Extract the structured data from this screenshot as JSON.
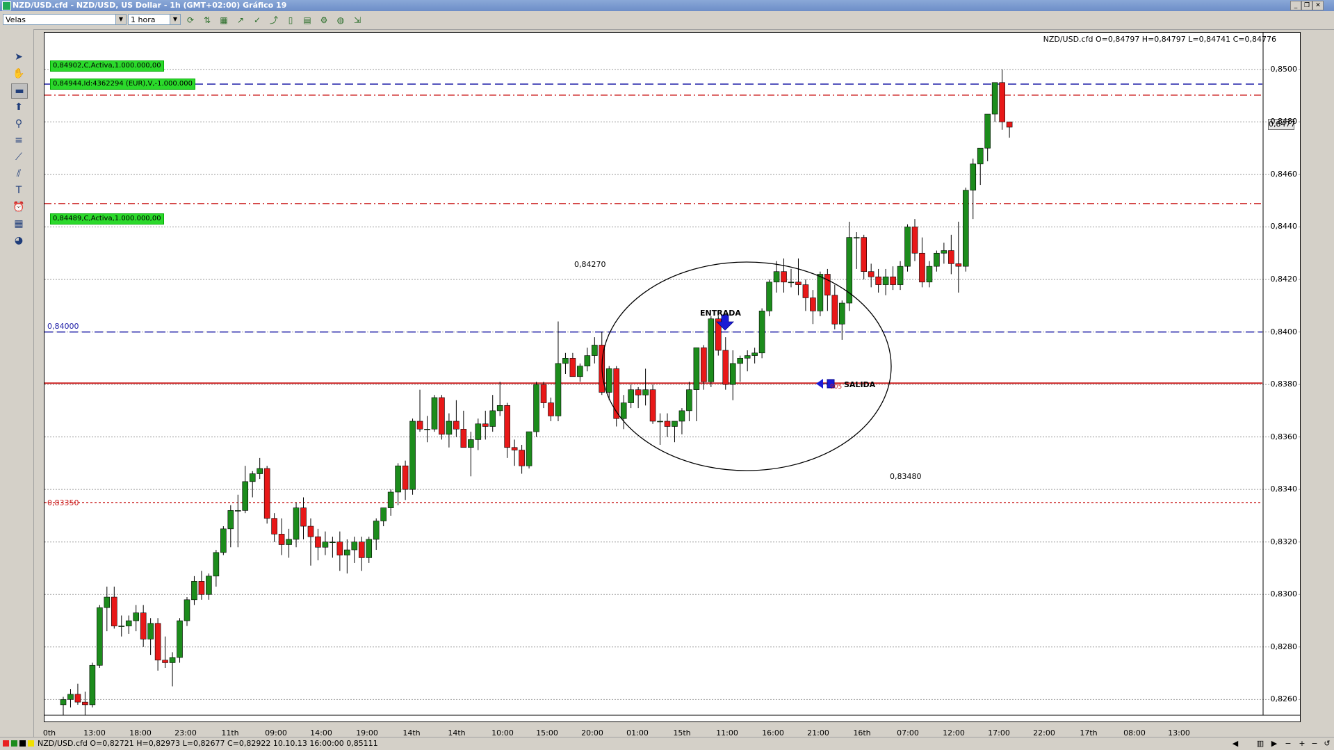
{
  "window": {
    "title": "NZD/USD.cfd - NZD/USD, US Dollar - 1h (GMT+02:00)   Gráfico 19"
  },
  "toolbar": {
    "chart_type_value": "Velas",
    "timeframe_value": "1 hora"
  },
  "chart": {
    "ohlc_readout": "NZD/USD.cfd O=0,84797 H=0,84797 L=0,84741 C=0,84776",
    "current_price_tag": "0,8477",
    "orders": [
      {
        "text": "0,84902,C,Activa,1.000.000,00"
      },
      {
        "text": "0,84944,Id:4362294 (EUR),V,-1.000.000"
      },
      {
        "text": "0,84489,C,Activa,1.000.000,00"
      }
    ],
    "level_labels": [
      {
        "text": "0,84000",
        "color": "#1a1aa6"
      },
      {
        "text": "0,83350",
        "color": "#cc2020"
      }
    ],
    "annotations": {
      "upper_value": "0,84270",
      "lower_value": "0,83480",
      "entry": "ENTRADA",
      "exit": "SALIDA",
      "exit_price_fragment": "905"
    },
    "colors": {
      "bull": "#1c8c1c",
      "bear": "#e81818",
      "hline_blue": "#1a1aa6",
      "hline_red": "#cc2020",
      "order_tag": "#2bd92b"
    }
  },
  "chart_data": {
    "type": "candlestick",
    "symbol": "NZD/USD.cfd",
    "timeframe": "1h",
    "ylim": [
      0.8254,
      0.8514
    ],
    "y_ticks": [
      "0,8500",
      "0,8480",
      "0,8460",
      "0,8440",
      "0,8420",
      "0,8400",
      "0,8380",
      "0,8360",
      "0,8340",
      "0,8320",
      "0,8300",
      "0,8280",
      "0,8260"
    ],
    "x_ticks": [
      "0th",
      "13:00",
      "18:00",
      "23:00",
      "11th",
      "09:00",
      "14:00",
      "19:00",
      "14th",
      "14th",
      "10:00",
      "15:00",
      "20:00",
      "01:00",
      "15th",
      "11:00",
      "16:00",
      "21:00",
      "16th",
      "07:00",
      "12:00",
      "17:00",
      "22:00",
      "17th",
      "08:00",
      "13:00"
    ],
    "candles": [
      {
        "o": 0.8258,
        "h": 0.8261,
        "l": 0.8254,
        "c": 0.826
      },
      {
        "o": 0.826,
        "h": 0.8264,
        "l": 0.8257,
        "c": 0.8262
      },
      {
        "o": 0.8262,
        "h": 0.8266,
        "l": 0.8258,
        "c": 0.8259
      },
      {
        "o": 0.8259,
        "h": 0.8263,
        "l": 0.8254,
        "c": 0.8258
      },
      {
        "o": 0.8258,
        "h": 0.8274,
        "l": 0.8257,
        "c": 0.8273
      },
      {
        "o": 0.8273,
        "h": 0.8296,
        "l": 0.8272,
        "c": 0.8295
      },
      {
        "o": 0.8295,
        "h": 0.8303,
        "l": 0.8286,
        "c": 0.8299
      },
      {
        "o": 0.8299,
        "h": 0.8303,
        "l": 0.8287,
        "c": 0.8288
      },
      {
        "o": 0.8288,
        "h": 0.8292,
        "l": 0.8284,
        "c": 0.8288
      },
      {
        "o": 0.8288,
        "h": 0.8292,
        "l": 0.8285,
        "c": 0.829
      },
      {
        "o": 0.829,
        "h": 0.8296,
        "l": 0.8286,
        "c": 0.8293
      },
      {
        "o": 0.8293,
        "h": 0.8296,
        "l": 0.828,
        "c": 0.8283
      },
      {
        "o": 0.8283,
        "h": 0.8291,
        "l": 0.8277,
        "c": 0.8289
      },
      {
        "o": 0.8289,
        "h": 0.8291,
        "l": 0.8271,
        "c": 0.8275
      },
      {
        "o": 0.8275,
        "h": 0.8284,
        "l": 0.8272,
        "c": 0.8274
      },
      {
        "o": 0.8274,
        "h": 0.8278,
        "l": 0.8265,
        "c": 0.8276
      },
      {
        "o": 0.8276,
        "h": 0.8291,
        "l": 0.8274,
        "c": 0.829
      },
      {
        "o": 0.829,
        "h": 0.8299,
        "l": 0.8288,
        "c": 0.8298
      },
      {
        "o": 0.8298,
        "h": 0.8307,
        "l": 0.8296,
        "c": 0.8305
      },
      {
        "o": 0.8305,
        "h": 0.8309,
        "l": 0.8298,
        "c": 0.83
      },
      {
        "o": 0.83,
        "h": 0.8308,
        "l": 0.8298,
        "c": 0.8307
      },
      {
        "o": 0.8307,
        "h": 0.8317,
        "l": 0.8303,
        "c": 0.8316
      },
      {
        "o": 0.8316,
        "h": 0.8326,
        "l": 0.8315,
        "c": 0.8325
      },
      {
        "o": 0.8325,
        "h": 0.8334,
        "l": 0.8318,
        "c": 0.8332
      },
      {
        "o": 0.8332,
        "h": 0.8338,
        "l": 0.8318,
        "c": 0.8332
      },
      {
        "o": 0.8332,
        "h": 0.8349,
        "l": 0.8331,
        "c": 0.8343
      },
      {
        "o": 0.8343,
        "h": 0.8347,
        "l": 0.8337,
        "c": 0.8346
      },
      {
        "o": 0.8346,
        "h": 0.8352,
        "l": 0.8344,
        "c": 0.8348
      },
      {
        "o": 0.8348,
        "h": 0.8349,
        "l": 0.8327,
        "c": 0.8329
      },
      {
        "o": 0.8329,
        "h": 0.8331,
        "l": 0.832,
        "c": 0.8323
      },
      {
        "o": 0.8323,
        "h": 0.8329,
        "l": 0.8315,
        "c": 0.8319
      },
      {
        "o": 0.8319,
        "h": 0.8325,
        "l": 0.8314,
        "c": 0.8321
      },
      {
        "o": 0.8321,
        "h": 0.8335,
        "l": 0.8318,
        "c": 0.8333
      },
      {
        "o": 0.8333,
        "h": 0.8337,
        "l": 0.8321,
        "c": 0.8326
      },
      {
        "o": 0.8326,
        "h": 0.8329,
        "l": 0.8311,
        "c": 0.8322
      },
      {
        "o": 0.8322,
        "h": 0.8325,
        "l": 0.8313,
        "c": 0.8318
      },
      {
        "o": 0.8318,
        "h": 0.8324,
        "l": 0.8315,
        "c": 0.832
      },
      {
        "o": 0.832,
        "h": 0.8322,
        "l": 0.8314,
        "c": 0.832
      },
      {
        "o": 0.832,
        "h": 0.8324,
        "l": 0.8309,
        "c": 0.8315
      },
      {
        "o": 0.8315,
        "h": 0.8321,
        "l": 0.8308,
        "c": 0.8317
      },
      {
        "o": 0.8317,
        "h": 0.8322,
        "l": 0.8312,
        "c": 0.832
      },
      {
        "o": 0.832,
        "h": 0.8322,
        "l": 0.8309,
        "c": 0.8314
      },
      {
        "o": 0.8314,
        "h": 0.8322,
        "l": 0.8312,
        "c": 0.8321
      },
      {
        "o": 0.8321,
        "h": 0.8329,
        "l": 0.8317,
        "c": 0.8328
      },
      {
        "o": 0.8328,
        "h": 0.8333,
        "l": 0.8326,
        "c": 0.8333
      },
      {
        "o": 0.8333,
        "h": 0.834,
        "l": 0.833,
        "c": 0.8339
      },
      {
        "o": 0.8339,
        "h": 0.835,
        "l": 0.8334,
        "c": 0.8349
      },
      {
        "o": 0.8349,
        "h": 0.8351,
        "l": 0.8336,
        "c": 0.834
      },
      {
        "o": 0.834,
        "h": 0.8367,
        "l": 0.8338,
        "c": 0.8366
      },
      {
        "o": 0.8366,
        "h": 0.8378,
        "l": 0.8362,
        "c": 0.8363
      },
      {
        "o": 0.8363,
        "h": 0.8368,
        "l": 0.8358,
        "c": 0.8363
      },
      {
        "o": 0.8363,
        "h": 0.8376,
        "l": 0.8362,
        "c": 0.8375
      },
      {
        "o": 0.8375,
        "h": 0.8376,
        "l": 0.8359,
        "c": 0.8361
      },
      {
        "o": 0.8361,
        "h": 0.8369,
        "l": 0.8356,
        "c": 0.8366
      },
      {
        "o": 0.8366,
        "h": 0.8374,
        "l": 0.836,
        "c": 0.8363
      },
      {
        "o": 0.8363,
        "h": 0.837,
        "l": 0.8356,
        "c": 0.8356
      },
      {
        "o": 0.8356,
        "h": 0.8362,
        "l": 0.8345,
        "c": 0.8359
      },
      {
        "o": 0.8359,
        "h": 0.8367,
        "l": 0.8355,
        "c": 0.8365
      },
      {
        "o": 0.8365,
        "h": 0.837,
        "l": 0.8359,
        "c": 0.8364
      },
      {
        "o": 0.8364,
        "h": 0.8376,
        "l": 0.8362,
        "c": 0.837
      },
      {
        "o": 0.837,
        "h": 0.8381,
        "l": 0.8368,
        "c": 0.8372
      },
      {
        "o": 0.8372,
        "h": 0.8373,
        "l": 0.8352,
        "c": 0.8356
      },
      {
        "o": 0.8356,
        "h": 0.8359,
        "l": 0.8349,
        "c": 0.8355
      },
      {
        "o": 0.8355,
        "h": 0.8357,
        "l": 0.8346,
        "c": 0.8349
      },
      {
        "o": 0.8349,
        "h": 0.8362,
        "l": 0.8348,
        "c": 0.8362
      },
      {
        "o": 0.8362,
        "h": 0.8381,
        "l": 0.836,
        "c": 0.838
      },
      {
        "o": 0.838,
        "h": 0.8381,
        "l": 0.8371,
        "c": 0.8373
      },
      {
        "o": 0.8373,
        "h": 0.8375,
        "l": 0.8366,
        "c": 0.8368
      },
      {
        "o": 0.8368,
        "h": 0.8404,
        "l": 0.8366,
        "c": 0.8388
      },
      {
        "o": 0.8388,
        "h": 0.8392,
        "l": 0.8384,
        "c": 0.839
      },
      {
        "o": 0.839,
        "h": 0.8392,
        "l": 0.8383,
        "c": 0.8383
      },
      {
        "o": 0.8383,
        "h": 0.8388,
        "l": 0.8381,
        "c": 0.8387
      },
      {
        "o": 0.8387,
        "h": 0.8394,
        "l": 0.8385,
        "c": 0.8391
      },
      {
        "o": 0.8391,
        "h": 0.8398,
        "l": 0.8388,
        "c": 0.8395
      },
      {
        "o": 0.8395,
        "h": 0.84,
        "l": 0.8376,
        "c": 0.8377
      },
      {
        "o": 0.8377,
        "h": 0.8387,
        "l": 0.8374,
        "c": 0.8386
      },
      {
        "o": 0.8386,
        "h": 0.8387,
        "l": 0.8364,
        "c": 0.8367
      },
      {
        "o": 0.8367,
        "h": 0.8376,
        "l": 0.8363,
        "c": 0.8373
      },
      {
        "o": 0.8373,
        "h": 0.838,
        "l": 0.8371,
        "c": 0.8378
      },
      {
        "o": 0.8378,
        "h": 0.8379,
        "l": 0.8371,
        "c": 0.8376
      },
      {
        "o": 0.8376,
        "h": 0.8386,
        "l": 0.8372,
        "c": 0.8378
      },
      {
        "o": 0.8378,
        "h": 0.838,
        "l": 0.8365,
        "c": 0.8366
      },
      {
        "o": 0.8366,
        "h": 0.8369,
        "l": 0.8357,
        "c": 0.8366
      },
      {
        "o": 0.8366,
        "h": 0.8369,
        "l": 0.836,
        "c": 0.8364
      },
      {
        "o": 0.8364,
        "h": 0.8366,
        "l": 0.8358,
        "c": 0.8366
      },
      {
        "o": 0.8366,
        "h": 0.8371,
        "l": 0.8361,
        "c": 0.837
      },
      {
        "o": 0.837,
        "h": 0.8381,
        "l": 0.8366,
        "c": 0.8378
      },
      {
        "o": 0.8378,
        "h": 0.8394,
        "l": 0.8366,
        "c": 0.8394
      },
      {
        "o": 0.8394,
        "h": 0.8395,
        "l": 0.8378,
        "c": 0.8381
      },
      {
        "o": 0.8381,
        "h": 0.8406,
        "l": 0.8379,
        "c": 0.8405
      },
      {
        "o": 0.8405,
        "h": 0.8406,
        "l": 0.8391,
        "c": 0.8393
      },
      {
        "o": 0.8393,
        "h": 0.8398,
        "l": 0.8378,
        "c": 0.838
      },
      {
        "o": 0.838,
        "h": 0.8393,
        "l": 0.8374,
        "c": 0.8388
      },
      {
        "o": 0.8388,
        "h": 0.8391,
        "l": 0.8381,
        "c": 0.839
      },
      {
        "o": 0.839,
        "h": 0.8393,
        "l": 0.8385,
        "c": 0.8391
      },
      {
        "o": 0.8391,
        "h": 0.8394,
        "l": 0.8388,
        "c": 0.8392
      },
      {
        "o": 0.8392,
        "h": 0.8409,
        "l": 0.839,
        "c": 0.8408
      },
      {
        "o": 0.8408,
        "h": 0.842,
        "l": 0.8406,
        "c": 0.8419
      },
      {
        "o": 0.8419,
        "h": 0.8427,
        "l": 0.8415,
        "c": 0.8423
      },
      {
        "o": 0.8423,
        "h": 0.8428,
        "l": 0.8415,
        "c": 0.8419
      },
      {
        "o": 0.8419,
        "h": 0.8424,
        "l": 0.8417,
        "c": 0.8419
      },
      {
        "o": 0.8419,
        "h": 0.8428,
        "l": 0.8414,
        "c": 0.8418
      },
      {
        "o": 0.8418,
        "h": 0.842,
        "l": 0.8408,
        "c": 0.8413
      },
      {
        "o": 0.8413,
        "h": 0.8416,
        "l": 0.8403,
        "c": 0.8408
      },
      {
        "o": 0.8408,
        "h": 0.8423,
        "l": 0.8406,
        "c": 0.8422
      },
      {
        "o": 0.8422,
        "h": 0.8424,
        "l": 0.8408,
        "c": 0.8414
      },
      {
        "o": 0.8414,
        "h": 0.8418,
        "l": 0.8401,
        "c": 0.8403
      },
      {
        "o": 0.8403,
        "h": 0.8412,
        "l": 0.8397,
        "c": 0.8411
      },
      {
        "o": 0.8411,
        "h": 0.8442,
        "l": 0.8408,
        "c": 0.8436
      },
      {
        "o": 0.8436,
        "h": 0.8438,
        "l": 0.8424,
        "c": 0.8436
      },
      {
        "o": 0.8436,
        "h": 0.8437,
        "l": 0.842,
        "c": 0.8423
      },
      {
        "o": 0.8423,
        "h": 0.8426,
        "l": 0.8417,
        "c": 0.8421
      },
      {
        "o": 0.8421,
        "h": 0.8424,
        "l": 0.8415,
        "c": 0.8418
      },
      {
        "o": 0.8418,
        "h": 0.8424,
        "l": 0.8414,
        "c": 0.8421
      },
      {
        "o": 0.8421,
        "h": 0.8425,
        "l": 0.8416,
        "c": 0.8418
      },
      {
        "o": 0.8418,
        "h": 0.8427,
        "l": 0.8416,
        "c": 0.8425
      },
      {
        "o": 0.8425,
        "h": 0.8441,
        "l": 0.8423,
        "c": 0.844
      },
      {
        "o": 0.844,
        "h": 0.8443,
        "l": 0.8427,
        "c": 0.843
      },
      {
        "o": 0.843,
        "h": 0.8436,
        "l": 0.8417,
        "c": 0.8419
      },
      {
        "o": 0.8419,
        "h": 0.8427,
        "l": 0.8417,
        "c": 0.8425
      },
      {
        "o": 0.8425,
        "h": 0.8431,
        "l": 0.8423,
        "c": 0.843
      },
      {
        "o": 0.843,
        "h": 0.8434,
        "l": 0.8426,
        "c": 0.8431
      },
      {
        "o": 0.8431,
        "h": 0.8437,
        "l": 0.8422,
        "c": 0.8426
      },
      {
        "o": 0.8426,
        "h": 0.8442,
        "l": 0.8415,
        "c": 0.8425
      },
      {
        "o": 0.8425,
        "h": 0.8455,
        "l": 0.8423,
        "c": 0.8454
      },
      {
        "o": 0.8454,
        "h": 0.8466,
        "l": 0.8443,
        "c": 0.8464
      },
      {
        "o": 0.8464,
        "h": 0.847,
        "l": 0.8456,
        "c": 0.847
      },
      {
        "o": 0.847,
        "h": 0.8483,
        "l": 0.8465,
        "c": 0.8483
      },
      {
        "o": 0.8483,
        "h": 0.8488,
        "l": 0.848,
        "c": 0.8495
      },
      {
        "o": 0.8495,
        "h": 0.85,
        "l": 0.8477,
        "c": 0.848
      },
      {
        "o": 0.848,
        "h": 0.848,
        "l": 0.8474,
        "c": 0.8478
      }
    ],
    "horizontal_lines": [
      {
        "value": 0.84944,
        "style": "dashed",
        "color": "#1a1aa6"
      },
      {
        "value": 0.84902,
        "style": "dash-dot",
        "color": "#cc2020"
      },
      {
        "value": 0.84489,
        "style": "dash-dot",
        "color": "#cc2020"
      },
      {
        "value": 0.84,
        "style": "dashed",
        "color": "#1a1aa6"
      },
      {
        "value": 0.83805,
        "style": "solid",
        "color": "#cc2020"
      },
      {
        "value": 0.8335,
        "style": "dotted",
        "color": "#cc2020"
      }
    ]
  },
  "statusbar": {
    "text": "NZD/USD.cfd O=0,82721 H=0,82973 L=0,82677 C=0,82922   10.10.13 16:00:00 0,85111"
  }
}
